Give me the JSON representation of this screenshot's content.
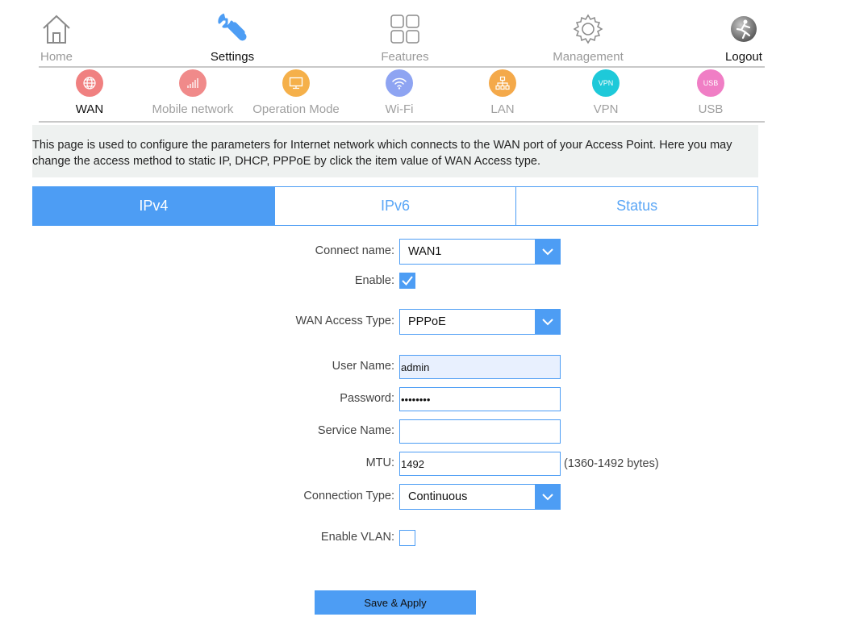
{
  "topnav": {
    "home": "Home",
    "settings": "Settings",
    "features": "Features",
    "management": "Management",
    "logout": "Logout"
  },
  "subnav": {
    "wan": "WAN",
    "mobile": "Mobile network",
    "opmode": "Operation Mode",
    "wifi": "Wi-Fi",
    "lan": "LAN",
    "vpn": "VPN",
    "usb": "USB",
    "vpn_icon_text": "VPN",
    "usb_icon_text": "USB"
  },
  "colors": {
    "accent": "#4d9df4",
    "wan": "#f08080",
    "mobile": "#f08a8a",
    "opmode": "#f5b04a",
    "wifi": "#8ea4f2",
    "lan": "#f4a94a",
    "vpn": "#1ec9d9",
    "usb": "#f07ec5"
  },
  "description": "This page is used to configure the parameters for Internet network which connects to the WAN port of your Access Point. Here you may change the access method to static IP, DHCP, PPPoE by click the item value of WAN Access type.",
  "tabs": {
    "ipv4": "IPv4",
    "ipv6": "IPv6",
    "status": "Status"
  },
  "form": {
    "connect_name_label": "Connect name:",
    "connect_name_value": "WAN1",
    "enable_label": "Enable:",
    "enable_checked": true,
    "wan_access_type_label": "WAN Access Type:",
    "wan_access_type_value": "PPPoE",
    "username_label": "User Name:",
    "username_value": "admin",
    "password_label": "Password:",
    "password_value": "password",
    "service_name_label": "Service Name:",
    "service_name_value": "",
    "mtu_label": "MTU:",
    "mtu_value": "1492",
    "mtu_hint": "(1360-1492 bytes)",
    "connection_type_label": "Connection Type:",
    "connection_type_value": "Continuous",
    "enable_vlan_label": "Enable VLAN:",
    "enable_vlan_checked": false
  },
  "save_label": "Save & Apply"
}
